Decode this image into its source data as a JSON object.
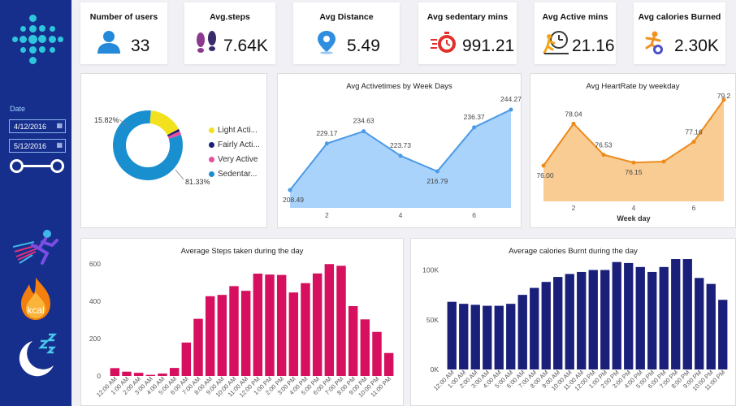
{
  "sidebar": {
    "date_label": "Date",
    "date_start": "4/12/2016",
    "date_end": "5/12/2016",
    "kcal_label": "kcal"
  },
  "kpis": [
    {
      "title": "Number of users",
      "value": "33",
      "icon": "user-icon"
    },
    {
      "title": "Avg.steps",
      "value": "7.64K",
      "icon": "footsteps-icon"
    },
    {
      "title": "Avg Distance",
      "value": "5.49",
      "icon": "location-pin-icon"
    },
    {
      "title": "Avg sedentary mins",
      "value": "991.21",
      "icon": "stopwatch-icon"
    },
    {
      "title": "Avg Active mins",
      "value": "21.16",
      "icon": "runner-clock-icon"
    },
    {
      "title": "Avg calories Burned",
      "value": "2.30K",
      "icon": "calorie-runner-icon"
    }
  ],
  "colors": {
    "sidebar": "#162f8c",
    "logo": "#2ec6dc",
    "pink": "#d6105e",
    "navy": "#1a1f7a",
    "blue_line": "#4a9ae8",
    "blue_area": "#a9d3fb",
    "orange_line": "#ee8a1b",
    "orange_area": "#f9cc93"
  },
  "chart_data": [
    {
      "type": "pie",
      "style": "donut",
      "slices": [
        {
          "name": "Light Acti...",
          "value": 15.82,
          "color": "#f2e11c"
        },
        {
          "name": "Fairly Acti...",
          "value": 1.11,
          "color": "#1a1f7a"
        },
        {
          "name": "Very Active",
          "value": 1.74,
          "color": "#e64fa0"
        },
        {
          "name": "Sedentar...",
          "value": 81.33,
          "color": "#1a8fd0"
        }
      ],
      "labels": [
        "15.82%",
        "81.33%"
      ]
    },
    {
      "type": "area",
      "title": "Avg Activetimes by Week Days",
      "x": [
        1,
        2,
        3,
        4,
        5,
        6,
        7
      ],
      "values": [
        208.49,
        229.17,
        234.63,
        223.73,
        216.79,
        236.37,
        244.27
      ],
      "xticks": [
        "2",
        "4",
        "6"
      ]
    },
    {
      "type": "area",
      "title": "Avg HeartRate by weekday",
      "xlabel": "Week day",
      "x": [
        1,
        2,
        3,
        4,
        5,
        6,
        7
      ],
      "values": [
        76.0,
        78.04,
        76.53,
        76.15,
        76.2,
        77.16,
        79.2
      ],
      "point_labels": [
        "76.00",
        "78.04",
        "76.53",
        "76.15",
        "",
        "77.16",
        "79.2"
      ],
      "xticks": [
        "2",
        "4",
        "6"
      ]
    },
    {
      "type": "bar",
      "title": "Average Steps taken during the day",
      "categories": [
        "12:00 AM",
        "1:00 AM",
        "2:00 AM",
        "3:00 AM",
        "4:00 AM",
        "5:00 AM",
        "6:00 AM",
        "7:00 AM",
        "8:00 AM",
        "9:00 AM",
        "10:00 AM",
        "11:00 AM",
        "12:00 PM",
        "1:00 PM",
        "2:00 PM",
        "3:00 PM",
        "4:00 PM",
        "5:00 PM",
        "6:00 PM",
        "7:00 PM",
        "8:00 PM",
        "9:00 PM",
        "10:00 PM",
        "11:00 PM"
      ],
      "values": [
        42,
        23,
        17,
        6,
        13,
        43,
        179,
        306,
        427,
        434,
        481,
        456,
        548,
        543,
        541,
        447,
        497,
        549,
        599,
        590,
        374,
        303,
        236,
        123
      ],
      "yticks": [
        "0",
        "200",
        "400",
        "600"
      ],
      "ylim": [
        0,
        600
      ]
    },
    {
      "type": "bar",
      "title": "Average calories Burnt during the day",
      "categories": [
        "12:00 AM",
        "1:00 AM",
        "2:00 AM",
        "3:00 AM",
        "4:00 AM",
        "5:00 AM",
        "6:00 AM",
        "7:00 AM",
        "8:00 AM",
        "9:00 AM",
        "10:00 AM",
        "11:00 AM",
        "12:00 PM",
        "1:00 PM",
        "2:00 PM",
        "3:00 PM",
        "4:00 PM",
        "5:00 PM",
        "6:00 PM",
        "7:00 PM",
        "8:00 PM",
        "9:00 PM",
        "10:00 PM",
        "11:00 PM"
      ],
      "values": [
        68000,
        66000,
        65000,
        64000,
        64000,
        66000,
        75000,
        82000,
        88000,
        93000,
        96000,
        98000,
        100000,
        100000,
        108000,
        107000,
        103000,
        98000,
        103000,
        111000,
        111000,
        92000,
        86000,
        70000
      ],
      "yticks": [
        "0K",
        "50K",
        "100K"
      ],
      "ylim": [
        0,
        120000
      ]
    }
  ]
}
